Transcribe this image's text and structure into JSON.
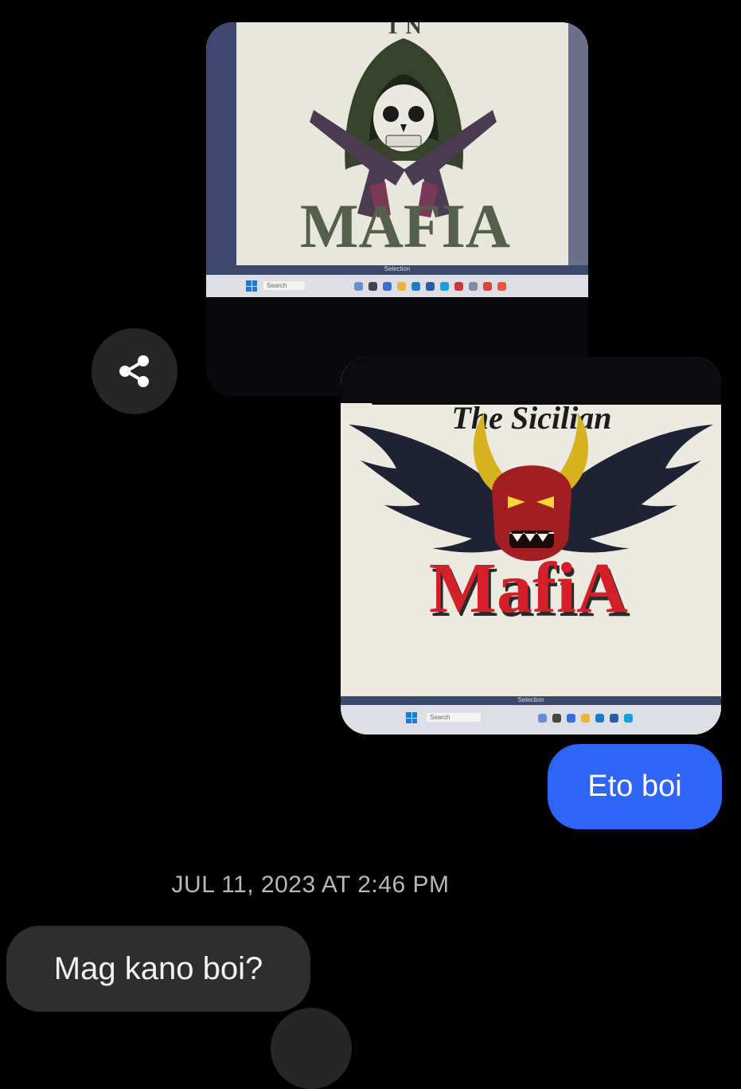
{
  "messages": {
    "photo1": {
      "logo_text": "MAFIA",
      "taskbar_label": "Selection",
      "search_placeholder": "Search"
    },
    "photo2": {
      "logo_top_text": "The Sicilian",
      "logo_text": "MafiA",
      "taskbar_label": "Selection",
      "search_placeholder": "Search"
    },
    "outgoing_text": "Eto boi",
    "timestamp": "JUL 11, 2023 AT 2:46 PM",
    "incoming_text": "Mag kano boi?"
  },
  "icons": {
    "share": "share-icon",
    "windows": "windows-logo-icon"
  },
  "colors": {
    "background": "#000000",
    "outgoing_bubble": "#2f65f5",
    "incoming_bubble": "#2e2e2e",
    "share_button": "#262626",
    "timestamp_text": "#b8b8b8"
  }
}
